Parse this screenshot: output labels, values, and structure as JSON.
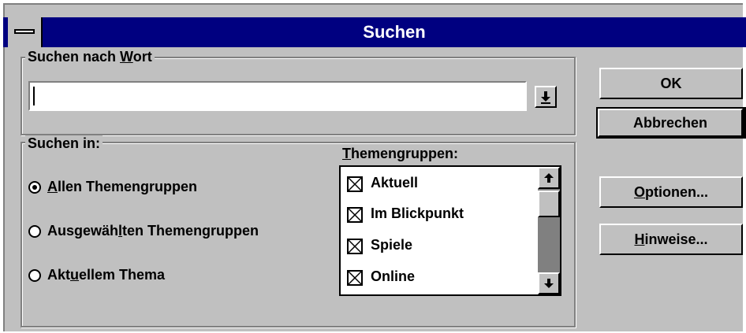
{
  "window": {
    "title": "Suchen"
  },
  "search_word": {
    "legend_pre": "Suchen nach ",
    "legend_hot": "W",
    "legend_post": "ort",
    "value": ""
  },
  "search_in": {
    "legend": "Suchen in:",
    "options": [
      {
        "pre": "",
        "hot": "A",
        "post": "llen Themengruppen",
        "selected": true
      },
      {
        "pre": "Ausgewäh",
        "hot": "l",
        "post": "ten Themengruppen",
        "selected": false
      },
      {
        "pre": "Akt",
        "hot": "u",
        "post": "ellem Thema",
        "selected": false
      }
    ]
  },
  "topics": {
    "label_hot": "T",
    "label_post": "hemengruppen:",
    "items": [
      {
        "label": "Aktuell",
        "checked": true
      },
      {
        "label": "Im Blickpunkt",
        "checked": true
      },
      {
        "label": "Spiele",
        "checked": true
      },
      {
        "label": "Online",
        "checked": true
      }
    ],
    "scroll_up_icon": "arrow-up-icon",
    "scroll_down_icon": "arrow-down-icon"
  },
  "buttons": {
    "ok": "OK",
    "cancel": "Abbrechen",
    "options_hot": "O",
    "options_post": "ptionen...",
    "hints_hot": "H",
    "hints_post": "inweise..."
  },
  "colors": {
    "title_bar": "#000080",
    "face": "#c0c0c0",
    "shadow": "#808080"
  }
}
